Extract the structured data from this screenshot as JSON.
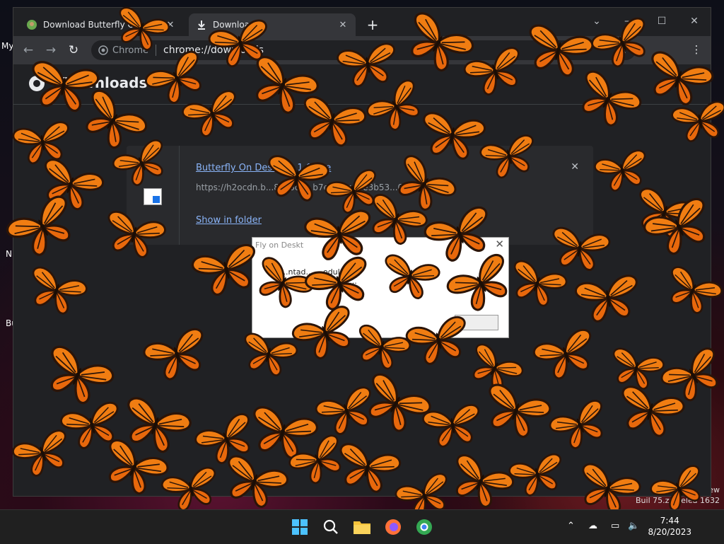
{
  "desktop": {
    "labels": [
      "My",
      "N",
      "Bu"
    ],
    "build_prefix": "Buil",
    "build_text": "75.zn_relea",
    "build_suffix": "1632",
    "build_top_right": "ew"
  },
  "browser": {
    "tabs": [
      {
        "label": "Download Butterfly O",
        "icon": "butterfly-favicon-icon"
      },
      {
        "label": "Downloads",
        "icon": "download-icon"
      }
    ],
    "omnibox": {
      "site_label": "Chrome",
      "url": "chrome://downloads"
    },
    "page_title": "Downloads",
    "download_item": {
      "file_name": "Butterfly On Desktop_1.0.exe",
      "file_url": "https://h2ocdn.b...86c8ce...b7e...41ce9e3b53...0fb3...",
      "show_in_folder": "Show in folder"
    }
  },
  "dialog": {
    "title": "Fly on Deskt",
    "body_line1": "...ntad... ...odule",
    "body_line2": "...te... ...s 722F3C..."
  },
  "taskbar": {
    "clock_time": "7:44",
    "clock_date": "8/20/2023"
  },
  "colors": {
    "accent_link": "#8ab4f8",
    "butterfly_orange": "#f07d12",
    "butterfly_vein": "#2b1408"
  }
}
